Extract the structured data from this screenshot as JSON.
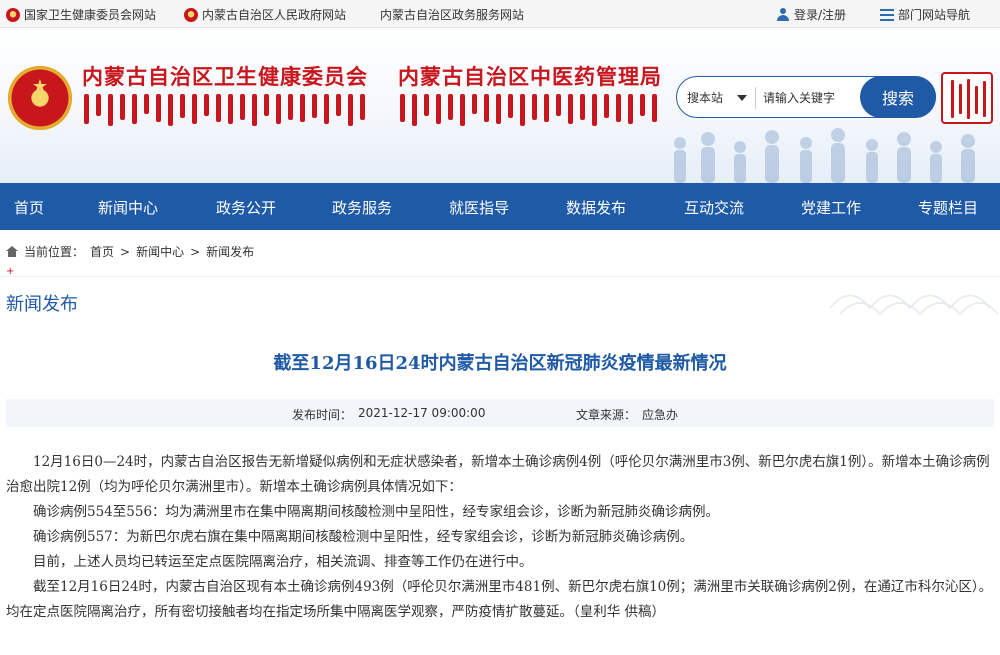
{
  "topbar": {
    "links": [
      "国家卫生健康委员会网站",
      "内蒙古自治区人民政府网站",
      "内蒙古自治区政务服务网站"
    ],
    "login": "登录/注册",
    "dept_nav": "部门网站导航"
  },
  "header": {
    "title_health": "内蒙古自治区卫生健康委员会",
    "title_tcm": "内蒙古自治区中医药管理局",
    "search": {
      "scope": "搜本站",
      "placeholder": "请输入关键字",
      "button": "搜索"
    }
  },
  "nav": {
    "items": [
      "首页",
      "新闻中心",
      "政务公开",
      "政务服务",
      "就医指导",
      "数据发布",
      "互动交流",
      "党建工作",
      "专题栏目"
    ]
  },
  "breadcrumb": {
    "label": "当前位置：",
    "items": [
      "首页",
      "新闻中心",
      "新闻发布"
    ],
    "separator": ">"
  },
  "section_title": "新闻发布",
  "article": {
    "title": "截至12月16日24时内蒙古自治区新冠肺炎疫情最新情况",
    "date_label": "发布时间：",
    "date": "2021-12-17 09:00:00",
    "source_label": "文章来源：",
    "source": "应急办",
    "paragraphs": [
      "12月16日0—24时，内蒙古自治区报告无新增疑似病例和无症状感染者，新增本土确诊病例4例（呼伦贝尔满洲里市3例、新巴尔虎右旗1例）。新增本土确诊病例治愈出院12例（均为呼伦贝尔满洲里市）。新增本土确诊病例具体情况如下：",
      "确诊病例554至556：均为满洲里市在集中隔离期间核酸检测中呈阳性，经专家组会诊，诊断为新冠肺炎确诊病例。",
      "确诊病例557：为新巴尔虎右旗在集中隔离期间核酸检测中呈阳性，经专家组会诊，诊断为新冠肺炎确诊病例。",
      "目前，上述人员均已转运至定点医院隔离治疗，相关流调、排查等工作仍在进行中。",
      "截至12月16日24时，内蒙古自治区现有本土确诊病例493例（呼伦贝尔满洲里市481例、新巴尔虎右旗10例；满洲里市关联确诊病例2例，在通辽市科尔沁区）。均在定点医院隔离治疗，所有密切接触者均在指定场所集中隔离医学观察，严防疫情扩散蔓延。（皇利华 供稿）"
    ]
  }
}
